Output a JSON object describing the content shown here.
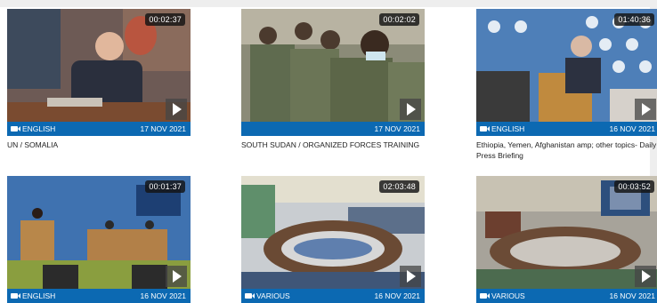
{
  "videos": [
    {
      "duration": "00:02:37",
      "language": "ENGLISH",
      "date": "17 NOV 2021",
      "title": "UN / SOMALIA"
    },
    {
      "duration": "00:02:02",
      "language": "",
      "date": "17 NOV 2021",
      "title": "SOUTH SUDAN / ORGANIZED FORCES TRAINING"
    },
    {
      "duration": "01:40:36",
      "language": "ENGLISH",
      "date": "16 NOV 2021",
      "title": "Ethiopia, Yemen, Afghanistan amp; other topics- Daily Press Briefing"
    },
    {
      "duration": "00:01:37",
      "language": "ENGLISH",
      "date": "16 NOV 2021",
      "title": ""
    },
    {
      "duration": "02:03:48",
      "language": "VARIOUS",
      "date": "16 NOV 2021",
      "title": ""
    },
    {
      "duration": "00:03:52",
      "language": "VARIOUS",
      "date": "16 NOV 2021",
      "title": ""
    }
  ],
  "colors": {
    "accent": "#0c69b2"
  },
  "icons": {
    "language": "video-camera-icon",
    "play": "play-icon"
  }
}
